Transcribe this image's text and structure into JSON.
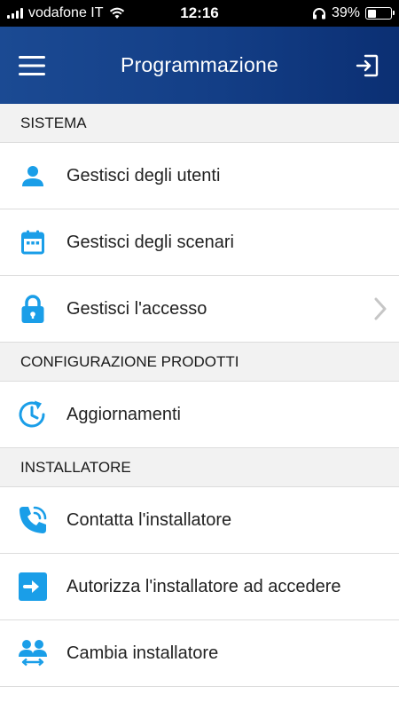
{
  "status_bar": {
    "carrier": "vodafone IT",
    "time": "12:16",
    "battery_percent": "39%",
    "battery_level": 0.39
  },
  "header": {
    "title": "Programmazione",
    "menu_icon": "hamburger-menu-icon",
    "exit_icon": "logout-icon"
  },
  "colors": {
    "header_bg": "#133e86",
    "accent": "#1a9ee8",
    "section_bg": "#f2f2f2"
  },
  "sections": [
    {
      "title": "SISTEMA",
      "items": [
        {
          "label": "Gestisci degli utenti",
          "icon": "user-icon"
        },
        {
          "label": "Gestisci degli scenari",
          "icon": "calendar-icon"
        },
        {
          "label": "Gestisci l'accesso",
          "icon": "lock-icon"
        }
      ]
    },
    {
      "title": "CONFIGURAZIONE PRODOTTI",
      "items": [
        {
          "label": "Aggiornamenti",
          "icon": "update-clock-icon"
        }
      ]
    },
    {
      "title": "INSTALLATORE",
      "items": [
        {
          "label": "Contatta l'installatore",
          "icon": "phone-call-icon"
        },
        {
          "label": "Autorizza l'installatore ad accedere",
          "icon": "authorize-arrow-icon"
        },
        {
          "label": "Cambia installatore",
          "icon": "swap-users-icon"
        }
      ]
    }
  ]
}
